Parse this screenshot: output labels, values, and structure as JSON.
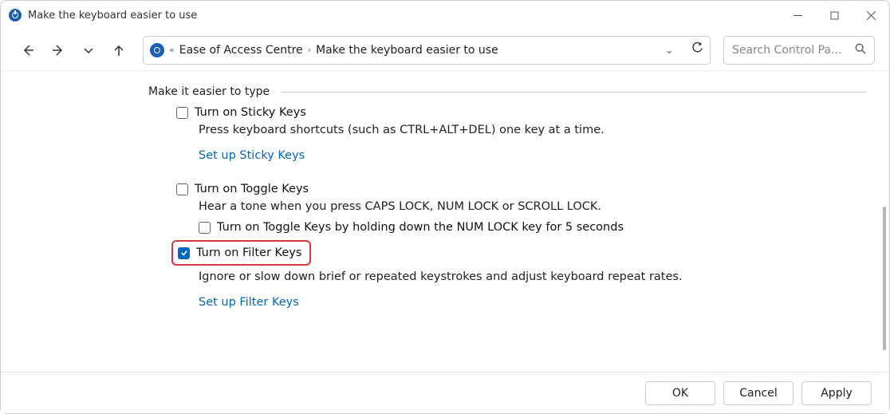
{
  "window": {
    "title": "Make the keyboard easier to use"
  },
  "breadcrumb": {
    "segment1": "Ease of Access Centre",
    "segment2": "Make the keyboard easier to use"
  },
  "search": {
    "placeholder": "Search Control Pa..."
  },
  "section": {
    "heading": "Make it easier to type"
  },
  "sticky": {
    "label": "Turn on Sticky Keys",
    "checked": false,
    "desc": "Press keyboard shortcuts (such as CTRL+ALT+DEL) one key at a time.",
    "link": "Set up Sticky Keys"
  },
  "toggle": {
    "label": "Turn on Toggle Keys",
    "checked": false,
    "desc": "Hear a tone when you press CAPS LOCK, NUM LOCK or SCROLL LOCK.",
    "sub_label": "Turn on Toggle Keys by holding down the NUM LOCK key for 5 seconds",
    "sub_checked": false
  },
  "filter": {
    "label": "Turn on Filter Keys",
    "checked": true,
    "desc": "Ignore or slow down brief or repeated keystrokes and adjust keyboard repeat rates.",
    "link": "Set up Filter Keys"
  },
  "buttons": {
    "ok": "OK",
    "cancel": "Cancel",
    "apply": "Apply"
  }
}
